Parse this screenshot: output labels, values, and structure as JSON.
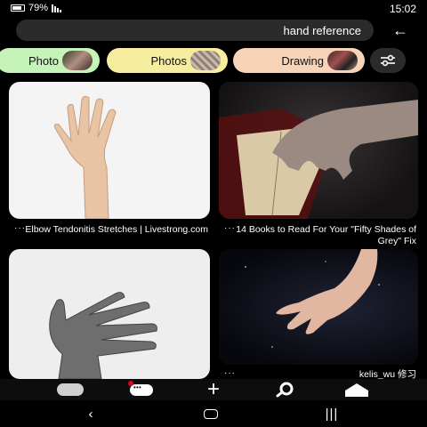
{
  "status_bar": {
    "time": "15:02",
    "battery": "79%"
  },
  "search": {
    "query": "hand reference"
  },
  "chips": [
    {
      "id": "filter",
      "icon": "sliders-icon"
    },
    {
      "id": "drawing",
      "label": "Drawing"
    },
    {
      "id": "photos",
      "label": "Photos"
    },
    {
      "id": "photo",
      "label": "Photo"
    }
  ],
  "pins": [
    {
      "title": "Elbow Tendonitis Stretches | Livestrong.com",
      "image": "raised open hand on white background"
    },
    {
      "title": "14 Books to Read For Your \"Fifty Shades of Grey\" Fix",
      "image": "hand holding open red book"
    },
    {
      "title": "",
      "image": "grey sculpted hand on white background"
    },
    {
      "title": "kelis_wu 修习",
      "image": "open palm on dark starry background"
    }
  ],
  "more_dots": "···",
  "nav": {
    "items": [
      {
        "id": "profile",
        "icon": "avatar-icon"
      },
      {
        "id": "messages",
        "icon": "chat-bubble-icon",
        "has_notification": true
      },
      {
        "id": "create",
        "icon": "plus-icon"
      },
      {
        "id": "search",
        "icon": "search-icon"
      },
      {
        "id": "home",
        "icon": "home-icon"
      }
    ]
  },
  "colors": {
    "chip_drawing": "#f7d4b8",
    "chip_photos": "#f6ed9e",
    "chip_photo": "#c6f3b7",
    "notification": "#e60023"
  }
}
